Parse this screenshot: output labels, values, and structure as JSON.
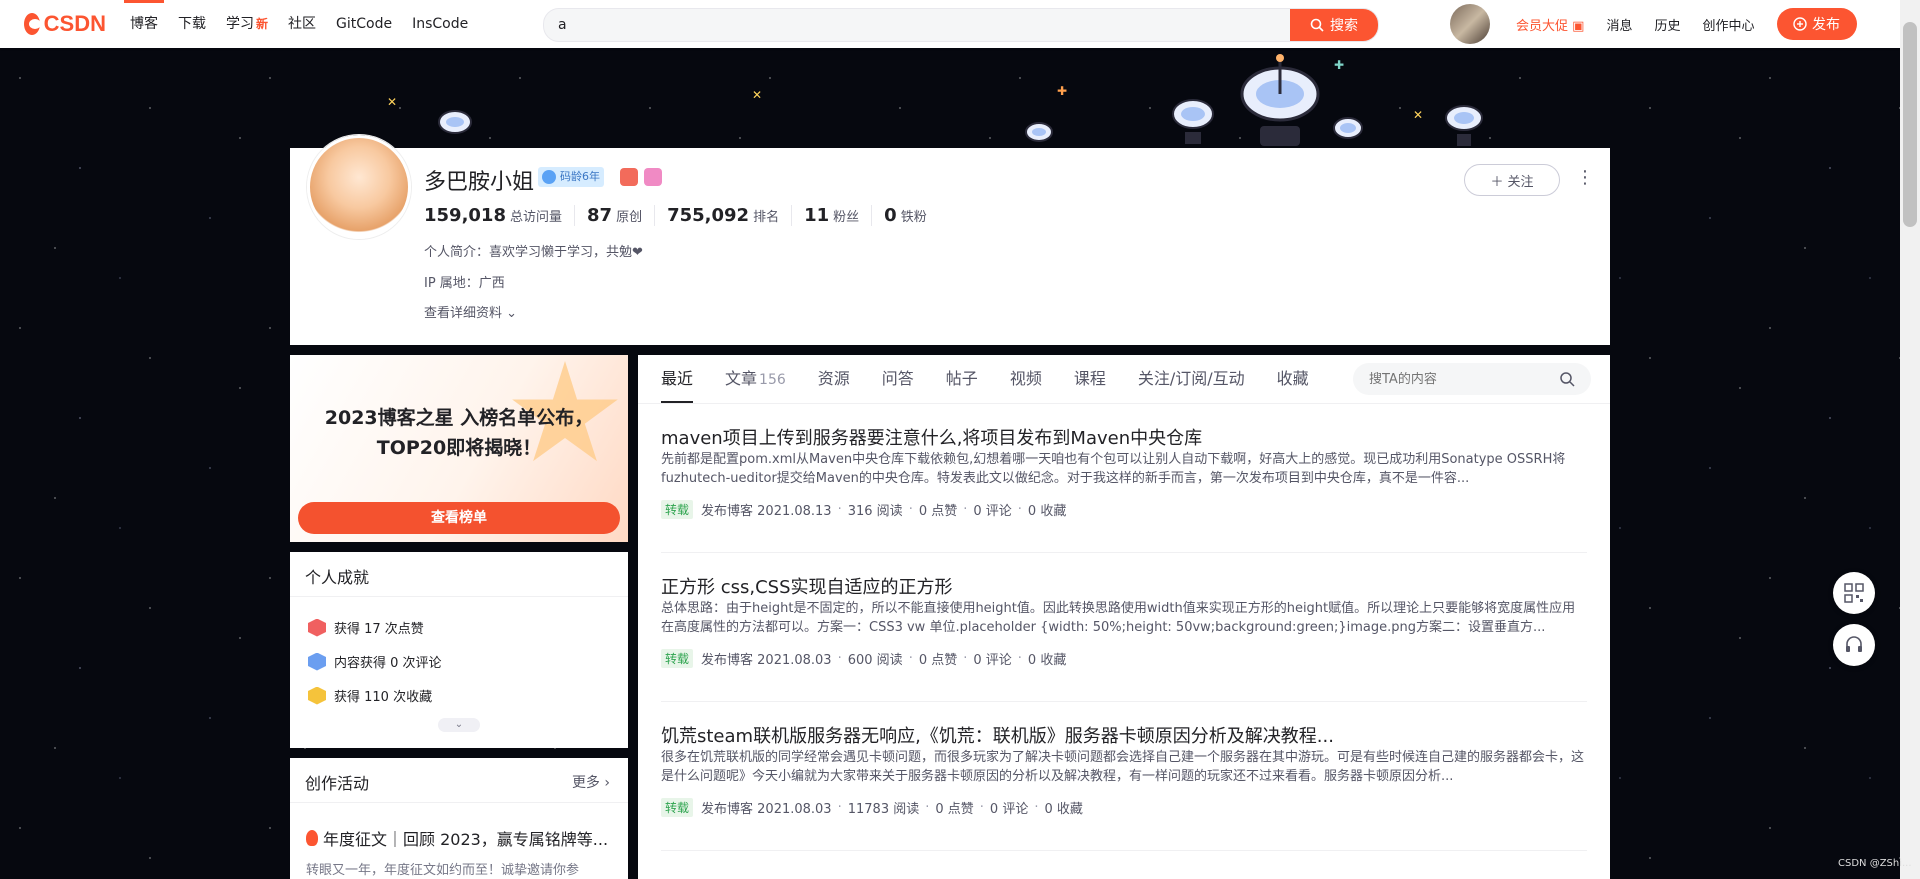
{
  "topbar": {
    "logo": "CSDN",
    "nav": [
      {
        "label": "博客",
        "badge": ""
      },
      {
        "label": "下载",
        "badge": ""
      },
      {
        "label": "学习",
        "badge": "新"
      },
      {
        "label": "社区",
        "badge": ""
      },
      {
        "label": "GitCode",
        "badge": ""
      },
      {
        "label": "InsCode",
        "badge": ""
      }
    ],
    "search_value": "a",
    "search_button": "搜索",
    "right": {
      "vip": "会员大促",
      "messages": "消息",
      "history": "历史",
      "creator": "创作中心",
      "publish": "发布"
    }
  },
  "profile": {
    "name": "多巴胺小姐",
    "age_badge": "码龄6年",
    "follow": "关注",
    "stats": [
      {
        "num": "159,018",
        "label": "总访问量"
      },
      {
        "num": "87",
        "label": "原创"
      },
      {
        "num": "755,092",
        "label": "排名"
      },
      {
        "num": "11",
        "label": "粉丝"
      },
      {
        "num": "0",
        "label": "铁粉"
      }
    ],
    "intro": "个人简介：喜欢学习懒于学习，共勉❤",
    "ip": "IP 属地：广西",
    "detail_link": "查看详细资料"
  },
  "promo": {
    "title_line1": "2023博客之星 入榜名单公布，",
    "title_line2": "TOP20即将揭晓！",
    "button": "查看榜单"
  },
  "achievements": {
    "title": "个人成就",
    "items": [
      {
        "text": "获得 17 次点赞",
        "color": "#f06060"
      },
      {
        "text": "内容获得 0 次评论",
        "color": "#6b9ef0"
      },
      {
        "text": "获得 110 次收藏",
        "color": "#f5c33b"
      }
    ]
  },
  "activity": {
    "title": "创作活动",
    "more": "更多",
    "item": "年度征文｜回顾 2023，赢专属铭牌等...",
    "sub": "转眼又一年，年度征文如约而至！诚挚邀请你参"
  },
  "main": {
    "tabs": [
      {
        "label": "最近",
        "count": ""
      },
      {
        "label": "文章",
        "count": "156"
      },
      {
        "label": "资源",
        "count": ""
      },
      {
        "label": "问答",
        "count": ""
      },
      {
        "label": "帖子",
        "count": ""
      },
      {
        "label": "视频",
        "count": ""
      },
      {
        "label": "课程",
        "count": ""
      },
      {
        "label": "关注/订阅/互动",
        "count": ""
      },
      {
        "label": "收藏",
        "count": ""
      }
    ],
    "search_placeholder": "搜TA的内容",
    "articles": [
      {
        "title": "maven项目上传到服务器要注意什么,将项目发布到Maven中央仓库",
        "desc": "先前都是配置pom.xml从Maven中央仓库下载依赖包,幻想着哪一天咱也有个包可以让别人自动下载啊，好高大上的感觉。现已成功利用Sonatype OSSRH将fuzhutech-ueditor提交给Maven的中央仓库。特发表此文以做纪念。对于我这样的新手而言，第一次发布项目到中央仓库，真不是一件容...",
        "tag": "转载",
        "date": "发布博客 2021.08.13",
        "reads": "316 阅读",
        "likes": "0 点赞",
        "comments": "0 评论",
        "favs": "0 收藏"
      },
      {
        "title": "正方形 css,CSS实现自适应的正方形",
        "desc": "总体思路：由于height是不固定的，所以不能直接使用height值。因此转换思路使用width值来实现正方形的height赋值。所以理论上只要能够将宽度属性应用在高度属性的方法都可以。方案一：CSS3 vw 单位.placeholder {width: 50%;height: 50vw;background:green;}image.png方案二：设置垂直方...",
        "tag": "转载",
        "date": "发布博客 2021.08.03",
        "reads": "600 阅读",
        "likes": "0 点赞",
        "comments": "0 评论",
        "favs": "0 收藏"
      },
      {
        "title": "饥荒steam联机版服务器无响应,《饥荒：联机版》服务器卡顿原因分析及解决教程...",
        "desc": "很多在饥荒联机版的同学经常会遇见卡顿问题，而很多玩家为了解决卡顿问题都会选择自己建一个服务器在其中游玩。可是有些时候连自己建的服务器都会卡，这是什么问题呢》今天小编就为大家带来关于服务器卡顿原因的分析以及解决教程，有一样问题的玩家还不过来看看。服务器卡顿原因分析...",
        "tag": "转载",
        "date": "发布博客 2021.08.03",
        "reads": "11783 阅读",
        "likes": "0 点赞",
        "comments": "0 评论",
        "favs": "0 收藏"
      }
    ]
  },
  "watermark": "CSDN @ZShi..."
}
